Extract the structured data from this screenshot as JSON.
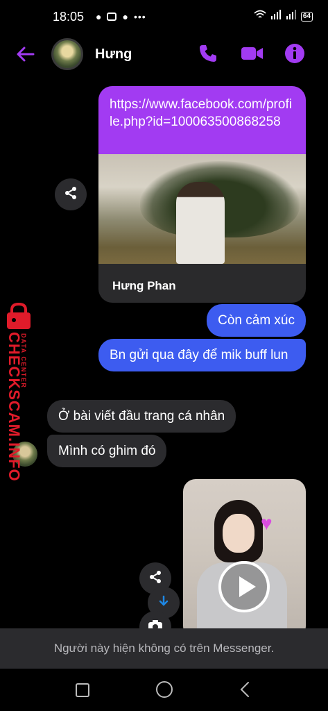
{
  "status_bar": {
    "time": "18:05",
    "battery": "64"
  },
  "header": {
    "contact_name": "Hưng"
  },
  "messages": {
    "link_card": {
      "url": "https://www.facebook.com/profile.php?id=100063500868258",
      "profile_name": "Hưng Phan"
    },
    "sent_1": "Còn  cảm xúc",
    "sent_2": "Bn gửi qua đây để mik buff lun",
    "received_1": "Ở bài viết đầu trang cá nhân",
    "received_2": "Mình có ghim đó"
  },
  "watermark": {
    "brand": "CHECKSCAM.INFO",
    "tagline": "DATA CENTER"
  },
  "notice": "Người này hiện không có trên Messenger.",
  "colors": {
    "accent": "#a23bf2",
    "bubble_sent": "#3d5cf0",
    "bubble_received": "#2b2b2e",
    "watermark": "#e01b2a"
  },
  "icons": [
    "back-arrow-icon",
    "phone-icon",
    "video-call-icon",
    "info-icon",
    "share-icon",
    "download-icon",
    "camera-icon",
    "play-icon",
    "nav-square-icon",
    "nav-home-icon",
    "nav-back-icon"
  ]
}
